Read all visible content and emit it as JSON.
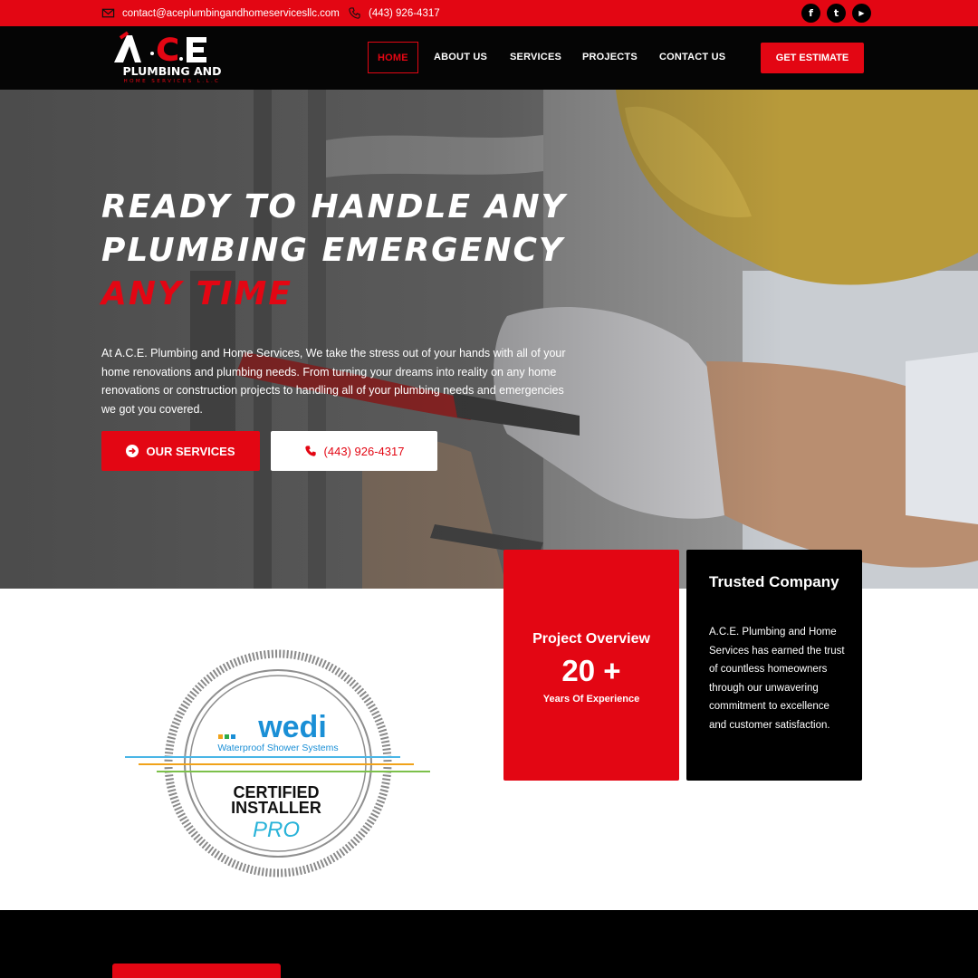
{
  "topbar": {
    "email": "contact@aceplumbingandhomeservicesllc.com",
    "phone": "(443) 926-4317",
    "socials": [
      {
        "icon": "facebook-icon",
        "glyph": "f"
      },
      {
        "icon": "twitter-icon",
        "glyph": "t"
      },
      {
        "icon": "youtube-icon",
        "glyph": "▶"
      }
    ]
  },
  "logo": {
    "line1": "ACE",
    "line2": "PLUMBING AND",
    "line3": "HOME SERVICES L.L.C"
  },
  "nav": {
    "items": [
      "HOME",
      "ABOUT US",
      "SERVICES",
      "PROJECTS",
      "CONTACT US"
    ],
    "active": "HOME",
    "cta": "GET ESTIMATE"
  },
  "hero": {
    "title_line1": "Ready to handle any",
    "title_line2": "plumbing emergency",
    "title_line3": "Any Time",
    "text": "At A.C.E. Plumbing and Home Services, We take the stress out of your hands with all of your home renovations and plumbing needs. From turning your dreams into reality on any home renovations or construction projects to handling all of your plumbing needs and emergencies we got you covered.",
    "btn_services": "OUR SERVICES",
    "btn_phone": "(443) 926-4317"
  },
  "cards": {
    "overview": {
      "title": "Project Overview",
      "number": "20 +",
      "subtitle": "Years Of Experience"
    },
    "trusted": {
      "title": "Trusted Company",
      "text": "A.C.E. Plumbing and Home Services has earned the trust of countless homeowners through our unwavering commitment to excellence and customer satisfaction."
    }
  },
  "badge": {
    "brand": "wedi",
    "tagline": "Waterproof Shower Systems",
    "line1": "CERTIFIED",
    "line2": "INSTALLER",
    "line3": "PRO"
  },
  "colors": {
    "accent": "#e30613",
    "dark": "#000000",
    "badge_blue": "#1a8fd6"
  }
}
